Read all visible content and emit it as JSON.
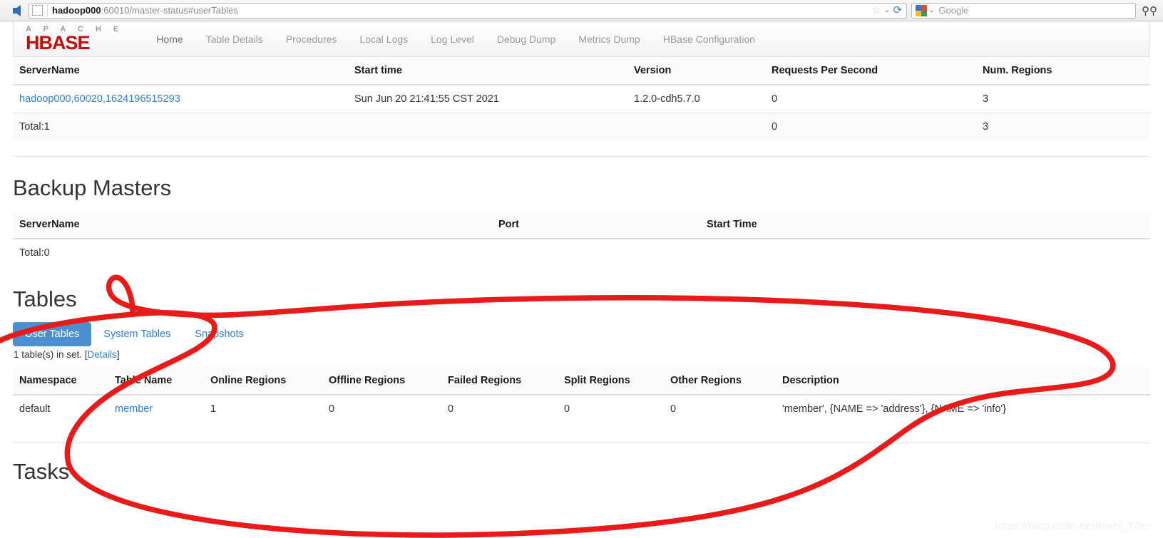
{
  "browser": {
    "back_icon": "back-arrow-icon",
    "url_host": "hadoop000",
    "url_rest": ":60010/master-status#userTables",
    "star_icon": "☆",
    "caret_icon": "⌄",
    "reload_icon": "⟳",
    "search_engine": "Google",
    "search_value": "",
    "binoculars_icon": "🔍"
  },
  "navbar": {
    "brand_top": "A P A C H E",
    "brand_main": "HBASE",
    "items": [
      {
        "label": "Home",
        "active": true
      },
      {
        "label": "Table Details",
        "active": false
      },
      {
        "label": "Procedures",
        "active": false
      },
      {
        "label": "Local Logs",
        "active": false
      },
      {
        "label": "Log Level",
        "active": false
      },
      {
        "label": "Debug Dump",
        "active": false
      },
      {
        "label": "Metrics Dump",
        "active": false
      },
      {
        "label": "HBase Configuration",
        "active": false
      }
    ]
  },
  "region_servers": {
    "headers": {
      "server_name": "ServerName",
      "start_time": "Start time",
      "version": "Version",
      "requests_per_second": "Requests Per Second",
      "num_regions": "Num. Regions"
    },
    "rows": [
      {
        "server_name": "hadoop000,60020,1624196515293",
        "start_time": "Sun Jun 20 21:41:55 CST 2021",
        "version": "1.2.0-cdh5.7.0",
        "requests_per_second": "0",
        "num_regions": "3"
      }
    ],
    "total": {
      "label": "Total:1",
      "requests_per_second": "0",
      "num_regions": "3"
    }
  },
  "backup_masters": {
    "title": "Backup Masters",
    "headers": {
      "server_name": "ServerName",
      "port": "Port",
      "start_time": "Start Time"
    },
    "rows": [],
    "total": "Total:0"
  },
  "tables": {
    "title": "Tables",
    "tabs": [
      {
        "label": "User Tables",
        "active": true
      },
      {
        "label": "System Tables",
        "active": false
      },
      {
        "label": "Snapshots",
        "active": false
      }
    ],
    "set_note_prefix": "1 table(s) in set. [",
    "set_note_link": "Details",
    "set_note_suffix": "]",
    "headers": {
      "namespace": "Namespace",
      "table_name": "Table Name",
      "online_regions": "Online Regions",
      "offline_regions": "Offline Regions",
      "failed_regions": "Failed Regions",
      "split_regions": "Split Regions",
      "other_regions": "Other Regions",
      "description": "Description"
    },
    "rows": [
      {
        "namespace": "default",
        "table_name": "member",
        "online_regions": "1",
        "offline_regions": "0",
        "failed_regions": "0",
        "split_regions": "0",
        "other_regions": "0",
        "description": "'member', {NAME => 'address'}, {NAME => 'info'}"
      }
    ]
  },
  "tasks": {
    "title": "Tasks"
  },
  "annotation": {
    "color": "#e81a1a",
    "shape": "hand-drawn-red-ellipse"
  },
  "watermark": {
    "text": "https://blog.csdn.net/level_Tiller"
  }
}
